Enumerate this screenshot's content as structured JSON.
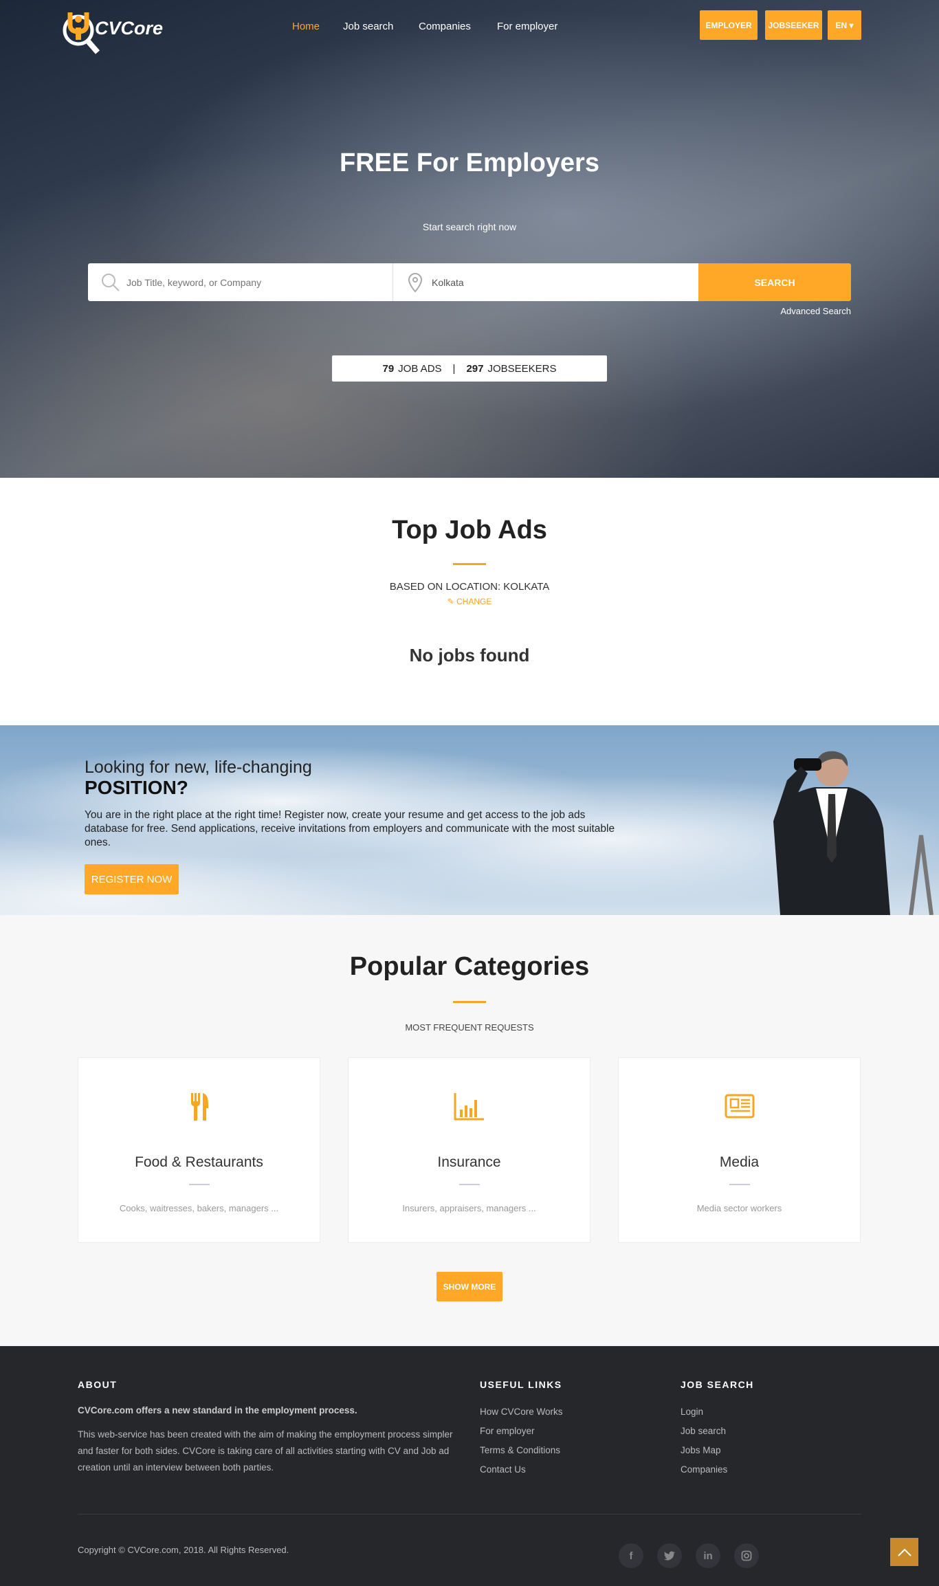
{
  "brand": {
    "logo_text": "CVCore",
    "accent": "#ffa726"
  },
  "nav": {
    "items": [
      "Home",
      "Job search",
      "Companies",
      "For employer"
    ],
    "active": "Home"
  },
  "top_buttons": {
    "employer": "EMPLOYER",
    "jobseeker": "JOBSEEKER",
    "language": "EN ▾"
  },
  "hero": {
    "title": "FREE For Employers",
    "subtitle": "Start search right now",
    "search": {
      "keyword_placeholder": "Job Title, keyword, or Company",
      "location_value": "Kolkata",
      "button": "SEARCH",
      "advanced": "Advanced Search"
    },
    "stats": {
      "job_ads_count": "79",
      "job_ads_label": "JOB ADS",
      "separator": "|",
      "jobseekers_count": "297",
      "jobseekers_label": "JOBSEEKERS"
    }
  },
  "top_jobs": {
    "title": "Top Job Ads",
    "location_label": "BASED ON LOCATION: KOLKATA",
    "change": "CHANGE",
    "empty": "No jobs found"
  },
  "banner": {
    "line1": "Looking for new, life-changing",
    "line2": "POSITION?",
    "text": "You are in the right place at the right time! Register now, create your resume and get access to the job ads database for free. Send applications, receive invitations from employers and communicate with the most suitable ones.",
    "button": "REGISTER NOW"
  },
  "categories": {
    "title": "Popular Categories",
    "subtitle": "MOST FREQUENT REQUESTS",
    "items": [
      {
        "icon": "utensils-icon",
        "name": "Food & Restaurants",
        "desc": "Cooks, waitresses, bakers, managers ..."
      },
      {
        "icon": "bar-chart-icon",
        "name": "Insurance",
        "desc": "Insurers, appraisers, managers ..."
      },
      {
        "icon": "newspaper-icon",
        "name": "Media",
        "desc": "Media sector workers"
      }
    ],
    "show_more": "SHOW MORE"
  },
  "footer": {
    "about": {
      "heading": "ABOUT",
      "lead": "CVCore.com offers a new standard in the employment process.",
      "text": "This web-service has been created with the aim of making the employment process simpler and faster for both sides. CVCore is taking care of all activities starting with CV and Job ad creation until an interview between both parties."
    },
    "useful": {
      "heading": "USEFUL LINKS",
      "links": [
        "How CVCore Works",
        "For employer",
        "Terms & Conditions",
        "Contact Us"
      ]
    },
    "jobsearch": {
      "heading": "JOB SEARCH",
      "links": [
        "Login",
        "Job search",
        "Jobs Map",
        "Companies"
      ]
    },
    "copyright": "Copyright © CVCore.com, 2018. All Rights Reserved.",
    "social": [
      "f",
      "t",
      "in",
      "ig"
    ]
  }
}
